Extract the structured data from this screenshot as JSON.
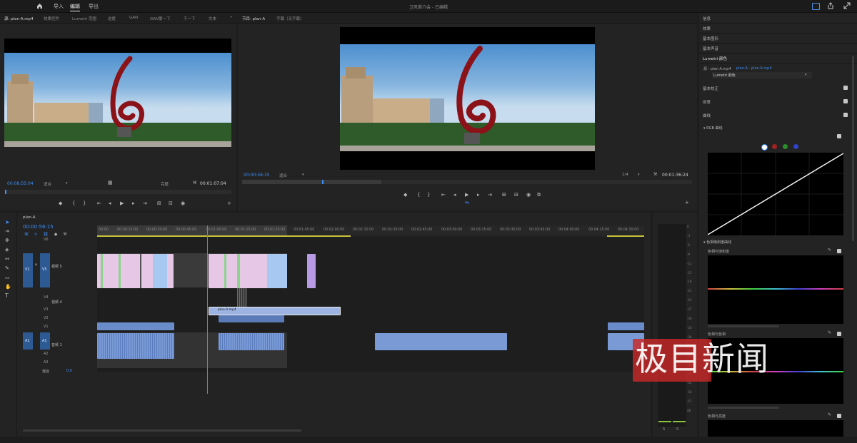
{
  "app": {
    "title": "卫风推介会 - 已编辑",
    "nav": [
      "导入",
      "编辑",
      "导出"
    ],
    "active_nav": "编辑"
  },
  "source_panel": {
    "tabs": [
      "源: plan-A.mp4",
      "效果控件",
      "Lumetri 范围",
      "进度",
      "GAN",
      "GAN第一下",
      "干一下",
      "文本"
    ],
    "timecode": "00:08:55:04",
    "fit": "适合",
    "quality": "完整",
    "duration": "00:01:07:04"
  },
  "program_panel": {
    "tabs": [
      "节目: plan-A",
      "字幕（无字幕）"
    ],
    "timecode": "00:00:56:15",
    "fit": "适合",
    "quality": "1/4",
    "duration": "00:01:36:24"
  },
  "timeline": {
    "tab": "plan-A",
    "timecode": "00:00:56:15",
    "ruler": [
      "00:00",
      "00:00:15:00",
      "00:00:30:00",
      "00:00:45:00",
      "00:01:00:00",
      "00:01:15:00",
      "00:01:30:00",
      "00:01:45:00",
      "00:02:00:00",
      "00:02:15:00",
      "00:02:30:00",
      "00:02:45:00",
      "00:03:00:00",
      "00:03:15:00",
      "00:03:30:00",
      "00:03:45:00",
      "00:04:00:00",
      "00:04:15:00",
      "00:04:30:00"
    ],
    "tracks": {
      "v6": "V6",
      "v5": "V5",
      "v5_name": "视频 5",
      "v4": "V4",
      "v4_name": "视频 4",
      "v3": "V3",
      "v2": "V2",
      "v1": "V1",
      "a1": "A1",
      "a1_name": "音频 1",
      "a2": "A2",
      "a3": "A3",
      "mix": "混合",
      "mix_value": "0.0",
      "src_v": "V1",
      "src_a": "A1"
    },
    "selected_clip": "plan-A.mp4"
  },
  "meter": {
    "scale": [
      "0",
      "-3",
      "-6",
      "-9",
      "-12",
      "-15",
      "-18",
      "-21",
      "-24",
      "-27",
      "-30",
      "-33",
      "-36",
      "-39",
      "-42",
      "-45",
      "-48",
      "-51",
      "-54",
      "-57",
      "dB"
    ],
    "labels": [
      "S",
      "S"
    ]
  },
  "right_panel": {
    "sections": [
      "信息",
      "效果",
      "基本图形",
      "基本声音",
      "Lumetri 颜色"
    ],
    "source_line": "源 - plan-A.mp4",
    "target_line": "plan-A - plan-A.mp4",
    "effect_name": "Lumetri 颜色",
    "items": [
      "基本校正",
      "创意",
      "曲线"
    ],
    "rgb_curve": "RGB 曲线",
    "hue_sat_header": "色相饱和度曲线",
    "hue_vs_sat": "色相与饱和度",
    "hue_vs_hue": "色相与色相",
    "hue_vs_luma": "色相与亮度"
  },
  "watermark": "极目新闻"
}
